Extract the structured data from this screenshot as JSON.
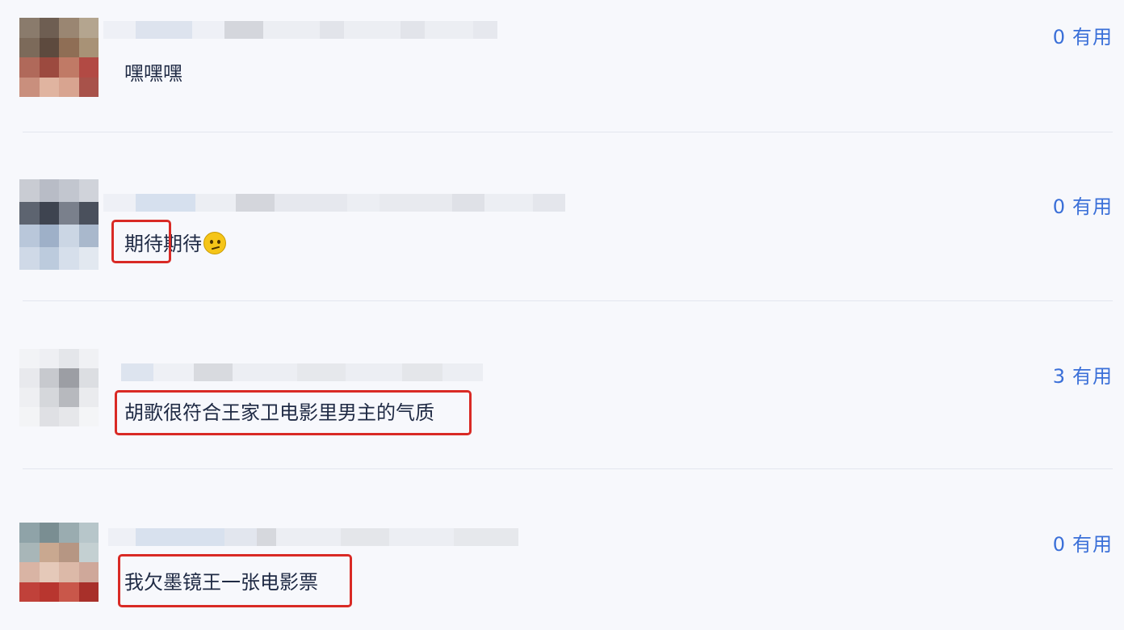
{
  "comments": [
    {
      "text": "嘿嘿嘿",
      "useful_count": "0",
      "useful_label": "有用"
    },
    {
      "text_highlight": "期待",
      "text_rest": "期待",
      "emoji": "thinking-face-emoji",
      "useful_count": "0",
      "useful_label": "有用"
    },
    {
      "text": "胡歌很符合王家卫电影里男主的气质",
      "useful_count": "3",
      "useful_label": "有用"
    },
    {
      "text": "我欠墨镜王一张电影票",
      "useful_count": "0",
      "useful_label": "有用"
    }
  ],
  "colors": {
    "background": "#f7f8fc",
    "text": "#1f2a44",
    "useful_link": "#3a6fd8",
    "highlight_border": "#d92a25",
    "divider": "#e3e6ef"
  }
}
